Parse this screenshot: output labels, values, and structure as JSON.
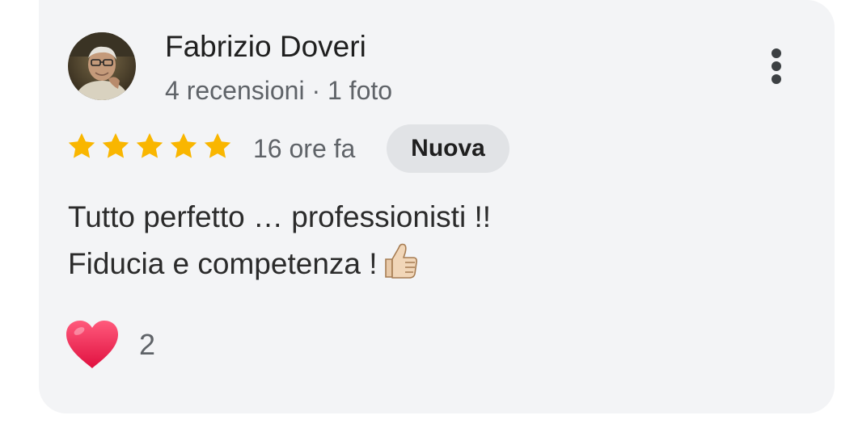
{
  "review": {
    "author": {
      "name": "Fabrizio Doveri",
      "meta": "4 recensioni · 1 foto",
      "avatar_icon": "avatar-photo"
    },
    "rating": {
      "stars": 5,
      "max": 5,
      "star_color": "#f9b600"
    },
    "time_ago": "16 ore fa",
    "badge": "Nuova",
    "text_lines": [
      "Tutto perfetto … professionisti !!",
      "Fiducia e competenza !"
    ],
    "text_emoji_icon": "thumbs-up-icon",
    "reactions": {
      "icon": "heart-icon",
      "count": "2",
      "color": "#f4295a"
    },
    "menu_icon": "more-vert-icon"
  },
  "colors": {
    "card_background": "#f3f4f6",
    "badge_background": "#e1e3e6",
    "primary_text": "#1f1f1f",
    "secondary_text": "#5f6368"
  }
}
